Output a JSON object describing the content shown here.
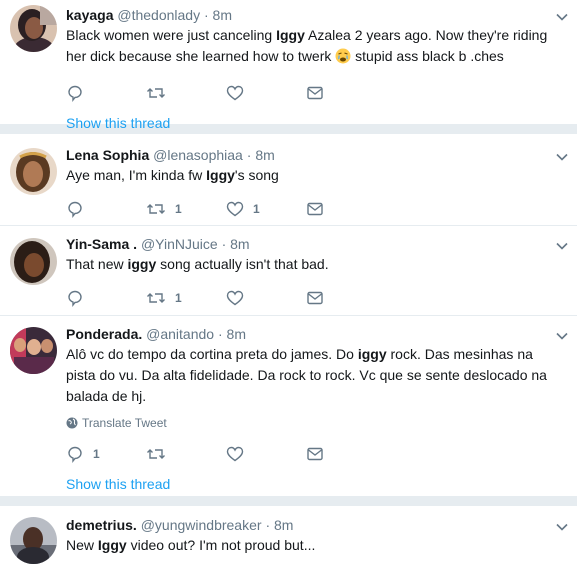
{
  "tweets": [
    {
      "fullname": "kayaga",
      "username": "@thedonlady",
      "time": "8m",
      "text_1": "Black women were just canceling ",
      "text_bold_1": "Iggy",
      "text_2": " Azalea 2 years ago. Now they're riding her dick because she learned how to twerk ",
      "text_3": " stupid ass black b .ches",
      "emoji": "weary-face-emoji",
      "reply_count": "",
      "retweet_count": "",
      "like_count": "",
      "show_thread": "Show this thread"
    },
    {
      "fullname": "Lena Sophia",
      "username": "@lenasophiaa",
      "time": "8m",
      "text_1": "Aye man, I'm kinda fw ",
      "text_bold_1": "Iggy",
      "text_2": "'s song",
      "reply_count": "",
      "retweet_count": "1",
      "like_count": "1"
    },
    {
      "fullname": "Yin-Sama .",
      "username": "@YinNJuice",
      "time": "8m",
      "text_1": "That new ",
      "text_bold_1": "iggy",
      "text_2": " song actually isn't that bad.",
      "reply_count": "",
      "retweet_count": "1",
      "like_count": ""
    },
    {
      "fullname": "Ponderada.",
      "username": "@anitando",
      "time": "8m",
      "text_1": "Alô vc do tempo da cortina preta do james. Do ",
      "text_bold_1": "iggy",
      "text_2": " rock. Das mesinhas na pista do vu. Da alta fidelidade. Da rock to rock. Vc que se sente deslocado na balada de hj.",
      "translate": "Translate Tweet",
      "reply_count": "1",
      "retweet_count": "",
      "like_count": "",
      "show_thread": "Show this thread"
    },
    {
      "fullname": "demetrius.",
      "username": "@yungwindbreaker",
      "time": "8m",
      "text_1": "New ",
      "text_bold_1": "Iggy",
      "text_2": " video out? I'm not proud but..."
    }
  ],
  "dot": "·",
  "colors": {
    "link": "#1da1f2",
    "secondary": "#657786",
    "primary": "#14171a",
    "divider": "#e6ecf0"
  }
}
